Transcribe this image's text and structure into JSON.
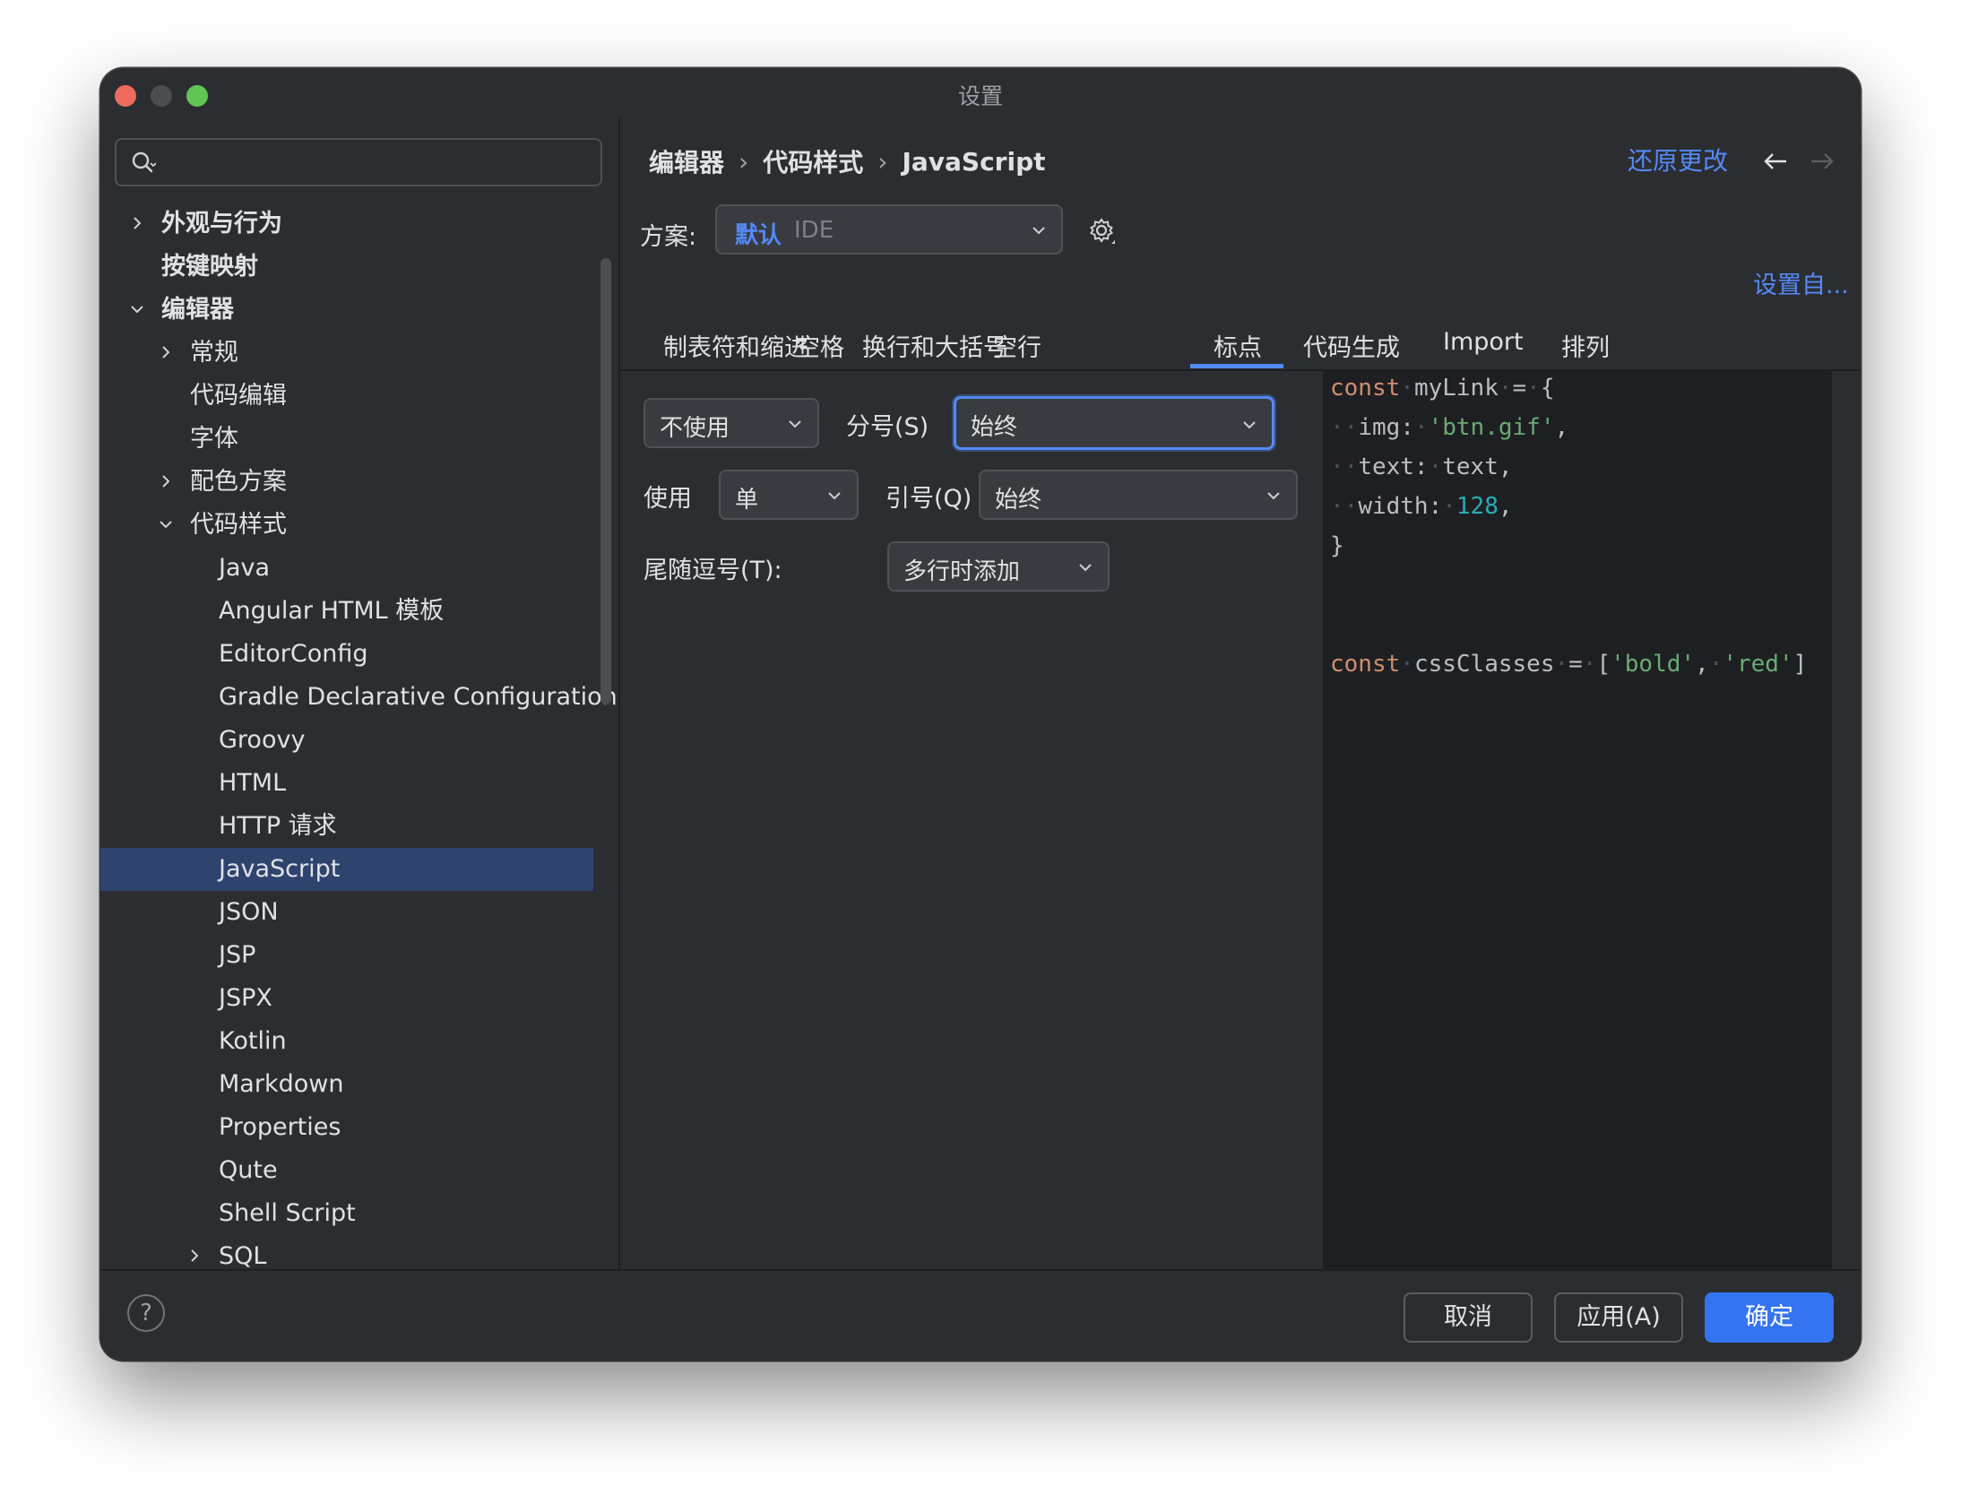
{
  "window": {
    "title": "设置"
  },
  "search": {
    "placeholder": ""
  },
  "sidebar": {
    "items": [
      {
        "label": "外观与行为",
        "chevron": "right"
      },
      {
        "label": "按键映射",
        "chevron": ""
      },
      {
        "label": "编辑器",
        "chevron": "down"
      },
      {
        "label": "常规",
        "chevron": "right"
      },
      {
        "label": "代码编辑",
        "chevron": ""
      },
      {
        "label": "字体",
        "chevron": ""
      },
      {
        "label": "配色方案",
        "chevron": "right"
      },
      {
        "label": "代码样式",
        "chevron": "down"
      },
      {
        "label": "Java",
        "chevron": ""
      },
      {
        "label": "Angular HTML 模板",
        "chevron": ""
      },
      {
        "label": "EditorConfig",
        "chevron": ""
      },
      {
        "label": "Gradle Declarative Configuration",
        "chevron": ""
      },
      {
        "label": "Groovy",
        "chevron": ""
      },
      {
        "label": "HTML",
        "chevron": ""
      },
      {
        "label": "HTTP 请求",
        "chevron": ""
      },
      {
        "label": "JavaScript",
        "chevron": "",
        "selected": true
      },
      {
        "label": "JSON",
        "chevron": ""
      },
      {
        "label": "JSP",
        "chevron": ""
      },
      {
        "label": "JSPX",
        "chevron": ""
      },
      {
        "label": "Kotlin",
        "chevron": ""
      },
      {
        "label": "Markdown",
        "chevron": ""
      },
      {
        "label": "Properties",
        "chevron": ""
      },
      {
        "label": "Qute",
        "chevron": ""
      },
      {
        "label": "Shell Script",
        "chevron": ""
      },
      {
        "label": "SQL",
        "chevron": "right"
      }
    ]
  },
  "breadcrumb": {
    "items": [
      "编辑器",
      "代码样式",
      "JavaScript"
    ],
    "separator": "›"
  },
  "header": {
    "revert_label": "还原更改",
    "back_icon": "arrow-left-icon",
    "forward_icon": "arrow-right-icon"
  },
  "scheme": {
    "label": "方案:",
    "name": "默认",
    "type": "IDE",
    "gear_icon": "gear-icon"
  },
  "set_from_label": "设置自...",
  "tabs": [
    "制表符和缩进",
    "空格",
    "换行和大括号",
    "空行",
    "标点",
    "代码生成",
    "Import",
    "排列"
  ],
  "active_tab": "标点",
  "form": {
    "semicolon_mode": "不使用",
    "semicolon_label": "分号(S)",
    "semicolon_value": "始终",
    "quote_use_label": "使用",
    "quote_type": "单",
    "quote_label": "引号(Q)",
    "quote_value": "始终",
    "trailing_comma_label": "尾随逗号(T):",
    "trailing_comma_value": "多行时添加"
  },
  "preview": {
    "lines": [
      {
        "tokens": [
          [
            "kw",
            "const"
          ],
          [
            "ws",
            "·"
          ],
          [
            "p",
            "myLink"
          ],
          [
            "ws",
            "·"
          ],
          [
            "p",
            "="
          ],
          [
            "ws",
            "·"
          ],
          [
            "p",
            "{"
          ]
        ]
      },
      {
        "tokens": [
          [
            "ws",
            "··"
          ],
          [
            "p",
            "img:"
          ],
          [
            "ws",
            "·"
          ],
          [
            "str",
            "'btn.gif'"
          ],
          [
            "p",
            ","
          ]
        ]
      },
      {
        "tokens": [
          [
            "ws",
            "··"
          ],
          [
            "p",
            "text:"
          ],
          [
            "ws",
            "·"
          ],
          [
            "p",
            "text,"
          ]
        ]
      },
      {
        "tokens": [
          [
            "ws",
            "··"
          ],
          [
            "p",
            "width:"
          ],
          [
            "ws",
            "·"
          ],
          [
            "num",
            "128"
          ],
          [
            "p",
            ","
          ]
        ]
      },
      {
        "tokens": [
          [
            "p",
            "}"
          ]
        ]
      },
      {
        "tokens": []
      },
      {
        "tokens": [
          [
            "kw",
            "const"
          ],
          [
            "ws",
            "·"
          ],
          [
            "p",
            "cssClasses"
          ],
          [
            "ws",
            "·"
          ],
          [
            "p",
            "="
          ],
          [
            "ws",
            "·"
          ],
          [
            "p",
            "["
          ],
          [
            "str",
            "'bold'"
          ],
          [
            "p",
            ","
          ],
          [
            "ws",
            "·"
          ],
          [
            "str",
            "'red'"
          ],
          [
            "p",
            "]"
          ]
        ]
      }
    ]
  },
  "footer": {
    "help_label": "?",
    "cancel_label": "取消",
    "apply_label": "应用(A)",
    "ok_label": "确定"
  },
  "colors": {
    "accent": "#548af7",
    "primary_button": "#3574f0",
    "selection": "#2e436e",
    "keyword": "#cf8e6d",
    "string": "#6aab73",
    "number": "#2aacb8"
  }
}
